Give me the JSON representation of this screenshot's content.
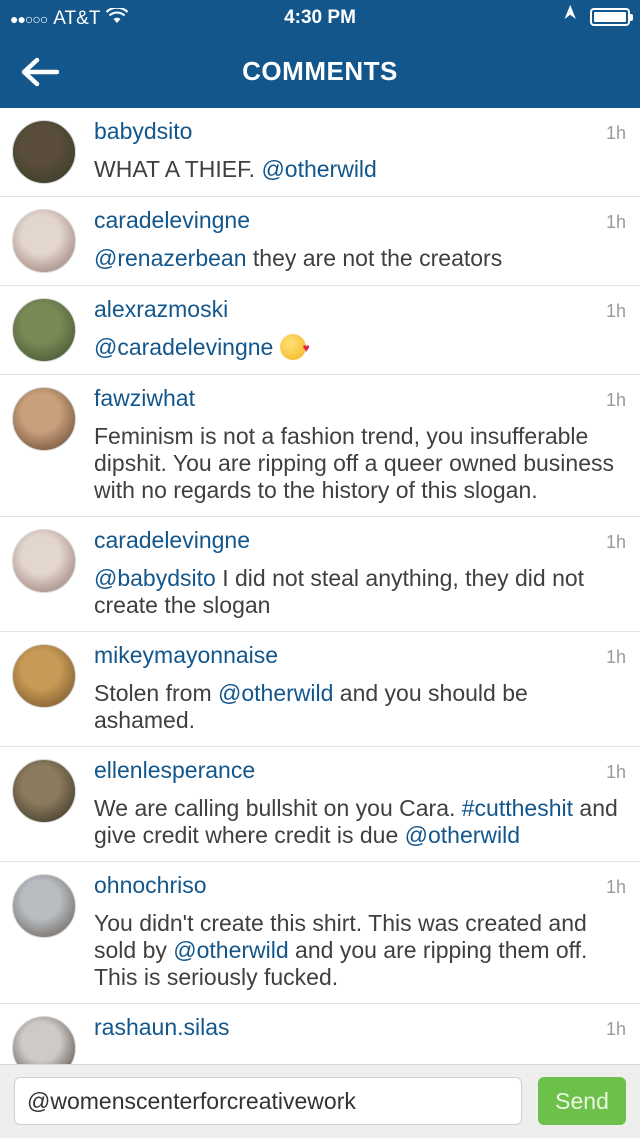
{
  "status_bar": {
    "carrier": "AT&T",
    "signal_dots": "●●○○○",
    "time": "4:30 PM",
    "wifi_icon": "wifi-icon",
    "location_icon": "location-arrow-icon",
    "battery_icon": "battery-icon"
  },
  "header": {
    "title": "COMMENTS",
    "back_icon": "back-arrow-icon",
    "background_color": "#12568c"
  },
  "comments": [
    {
      "username": "babydsito",
      "time": "1h",
      "segments": [
        {
          "t": "WHAT A THIEF. ",
          "k": "text"
        },
        {
          "t": "@otherwild",
          "k": "mention"
        }
      ]
    },
    {
      "username": "caradelevingne",
      "time": "1h",
      "segments": [
        {
          "t": "@renazerbean",
          "k": "mention"
        },
        {
          "t": " they are not the creators",
          "k": "text"
        }
      ]
    },
    {
      "username": "alexrazmoski",
      "time": "1h",
      "segments": [
        {
          "t": "@caradelevingne",
          "k": "mention"
        },
        {
          "t": " ",
          "k": "text"
        },
        {
          "t": "kissing-face-emoji",
          "k": "emoji"
        }
      ]
    },
    {
      "username": "fawziwhat",
      "time": "1h",
      "segments": [
        {
          "t": "Feminism is not a fashion trend, you insufferable dipshit. You are ripping off a queer owned business with no regards to the history of this slogan.",
          "k": "text"
        }
      ]
    },
    {
      "username": "caradelevingne",
      "time": "1h",
      "segments": [
        {
          "t": "@babydsito",
          "k": "mention"
        },
        {
          "t": " I did not steal anything, they did not create the slogan",
          "k": "text"
        }
      ]
    },
    {
      "username": "mikeymayonnaise",
      "time": "1h",
      "segments": [
        {
          "t": "Stolen from ",
          "k": "text"
        },
        {
          "t": "@otherwild",
          "k": "mention"
        },
        {
          "t": " and you should be ashamed.",
          "k": "text"
        }
      ]
    },
    {
      "username": "ellenlesperance",
      "time": "1h",
      "segments": [
        {
          "t": "We are calling bullshit on you Cara. ",
          "k": "text"
        },
        {
          "t": "#cuttheshit",
          "k": "hashtag"
        },
        {
          "t": " and give credit where credit is due ",
          "k": "text"
        },
        {
          "t": "@otherwild",
          "k": "mention"
        }
      ]
    },
    {
      "username": "ohnochriso",
      "time": "1h",
      "segments": [
        {
          "t": "You didn't create this shirt. This was created and sold by ",
          "k": "text"
        },
        {
          "t": "@otherwild",
          "k": "mention"
        },
        {
          "t": " and you are ripping them off. This is seriously fucked.",
          "k": "text"
        }
      ]
    },
    {
      "username": "rashaun.silas",
      "time": "1h",
      "segments": []
    }
  ],
  "composer": {
    "value": "@womenscenterforcreativework",
    "send_label": "Send",
    "send_color": "#6dc14a"
  }
}
